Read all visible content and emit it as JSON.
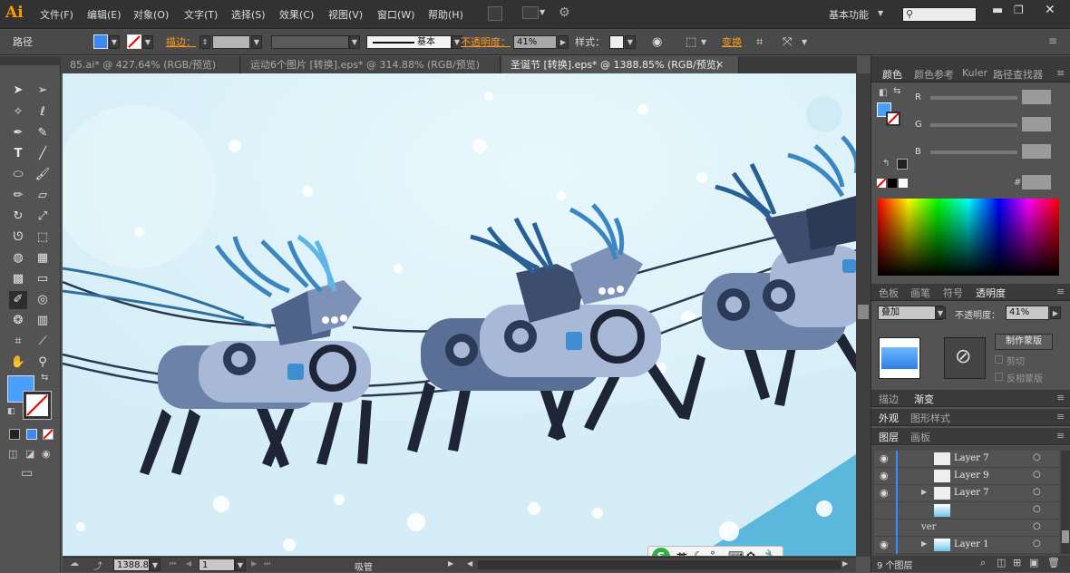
{
  "app": {
    "logo": "Ai",
    "workspace": "基本功能"
  },
  "menu": [
    "文件(F)",
    "编辑(E)",
    "对象(O)",
    "文字(T)",
    "选择(S)",
    "效果(C)",
    "视图(V)",
    "窗口(W)",
    "帮助(H)"
  ],
  "control": {
    "object_type": "路径",
    "stroke_label": "描边：",
    "stroke_style": "基本",
    "opacity_label": "不透明度：",
    "opacity_value": "41%",
    "style_label": "样式：",
    "transform_label": "变换"
  },
  "tabs": [
    {
      "label": "85.ai* @ 427.64% (RGB/预览)"
    },
    {
      "label": "运动6个图片 [转换].eps* @ 314.88% (RGB/预览)"
    },
    {
      "label": "圣诞节 [转换].eps* @ 1388.85% (RGB/预览)"
    }
  ],
  "status": {
    "zoom": "1388.8",
    "artboard": "1",
    "tool": "吸管"
  },
  "ime": {
    "lang": "英"
  },
  "color_panel": {
    "tabs": [
      "颜色",
      "颜色参考",
      "Kuler",
      "路径查找器"
    ],
    "channels": [
      "R",
      "G",
      "B"
    ],
    "hex_label": "#"
  },
  "transparency_panel": {
    "tabs": [
      "色板",
      "画笔",
      "符号",
      "透明度"
    ],
    "blend_mode": "叠加",
    "opacity_label": "不透明度：",
    "opacity_value": "41%",
    "make_mask": "制作蒙版",
    "clip": "剪切",
    "invert_mask": "反相蒙版"
  },
  "stroke_panel": {
    "tabs": [
      "描边",
      "渐变"
    ]
  },
  "appearance_panel": {
    "tabs": [
      "外观",
      "图形样式"
    ]
  },
  "layers_panel": {
    "tabs": [
      "图层",
      "画板"
    ],
    "rows": [
      "Layer 7",
      "Layer 9",
      "Layer 7",
      "",
      "Layer 1"
    ],
    "partial": "ver",
    "footer": "9 个图层"
  },
  "colors": {
    "accent": "#3d8af7",
    "fill": "#4a90e8",
    "canvas": "#dff3fb"
  }
}
